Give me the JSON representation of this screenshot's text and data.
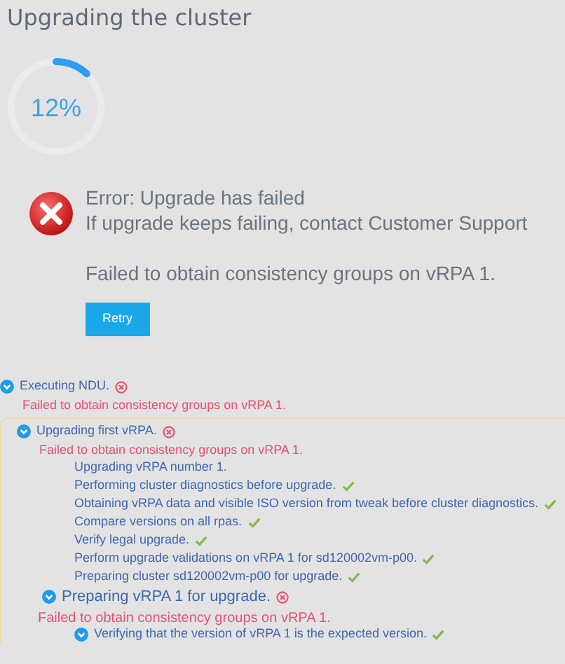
{
  "title": "Upgrading the cluster",
  "progress": {
    "reading": "12%"
  },
  "error": {
    "heading": "Error: Upgrade has failed",
    "hint": "If upgrade keeps failing, contact Customer Support",
    "detail": "Failed to obtain consistency groups on vRPA 1.",
    "button": "Retry"
  },
  "tasks": [
    {
      "label": "Executing NDU.",
      "kind": "group",
      "succeeded": false,
      "expanded": true,
      "error": "Failed to obtain consistency groups on vRPA 1.",
      "children": [
        {
          "label": "Upgrading first vRPA.",
          "kind": "group",
          "succeeded": false,
          "expanded": true,
          "error": "Failed to obtain consistency groups on vRPA 1.",
          "children": [
            {
              "label": "Upgrading vRPA number 1.",
              "kind": "step"
            },
            {
              "label": "Performing cluster diagnostics before upgrade.",
              "kind": "step",
              "succeeded": true
            },
            {
              "label": "Obtaining vRPA data and visible ISO version from tweak before cluster diagnostics.",
              "kind": "step",
              "succeeded": true
            },
            {
              "label": "Compare versions on all rpas.",
              "kind": "step",
              "succeeded": true
            },
            {
              "label": "Verify legal upgrade.",
              "kind": "step",
              "succeeded": true
            },
            {
              "label": "Perform upgrade validations on vRPA 1 for sd120002vm-p00.",
              "kind": "step",
              "succeeded": true
            },
            {
              "label": "Preparing cluster sd120002vm-p00 for upgrade.",
              "kind": "step",
              "succeeded": true
            },
            {
              "label": "Preparing vRPA 1 for upgrade.",
              "kind": "stage",
              "succeeded": false,
              "expanded": true,
              "error": "Failed to obtain consistency groups on vRPA 1.",
              "children": [
                {
                  "label": "Verifying that the version of vRPA 1 is the expected version.",
                  "kind": "substep",
                  "succeeded": true,
                  "expanded": true
                }
              ]
            }
          ]
        }
      ]
    }
  ]
}
